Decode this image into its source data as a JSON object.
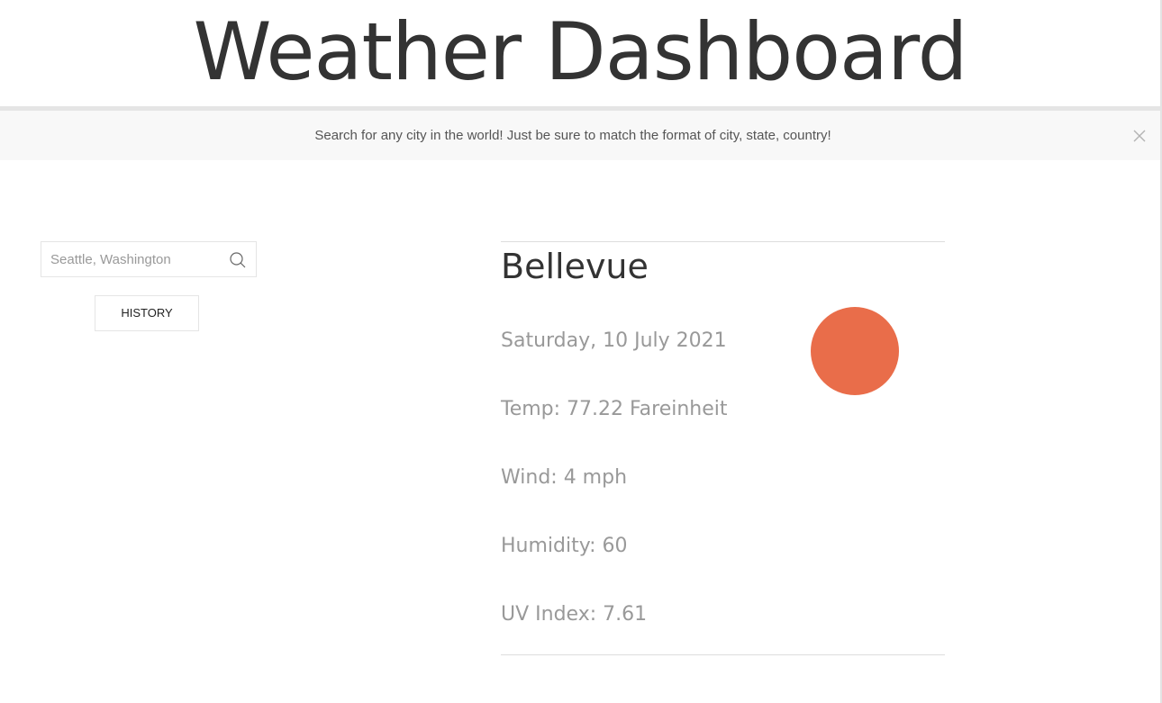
{
  "header": {
    "title": "Weather Dashboard"
  },
  "notice": {
    "text": "Search for any city in the world! Just be sure to match the format of city, state, country!",
    "close_icon": "close-icon"
  },
  "search": {
    "placeholder": "Seattle, Washington",
    "value": "",
    "icon": "search-icon"
  },
  "history": {
    "label": "HISTORY"
  },
  "weather": {
    "city": "Bellevue",
    "date": "Saturday, 10 July 2021",
    "temp": "Temp: 77.22 Fareinheit",
    "wind": "Wind: 4 mph",
    "humidity": "Humidity: 60",
    "uv_index": "UV Index: 7.61",
    "uv_indicator_color": "#e96d4a"
  },
  "colors": {
    "uv_indicator": "#e96d4a",
    "notice_background": "#f8f8f8",
    "muted_text": "#999999"
  }
}
